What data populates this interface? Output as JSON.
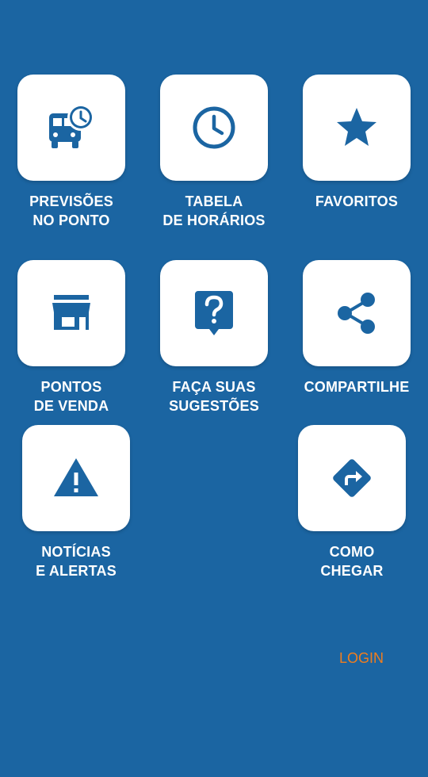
{
  "colors": {
    "background": "#1B65A2",
    "tile": "#FFFFFF",
    "icon": "#1B65A2",
    "label": "#FFFFFF",
    "login": "#F07D1E"
  },
  "menu": {
    "previsoes": {
      "icon": "bus-clock-icon",
      "line1": "PREVISÕES",
      "line2": "NO PONTO"
    },
    "tabela": {
      "icon": "clock-icon",
      "line1": "TABELA",
      "line2": "DE HORÁRIOS"
    },
    "favoritos": {
      "icon": "star-icon",
      "line1": "FAVORITOS"
    },
    "pontos_venda": {
      "icon": "store-icon",
      "line1": "PONTOS",
      "line2": "DE VENDA"
    },
    "sugestoes": {
      "icon": "question-feedback-icon",
      "line1": "FAÇA SUAS",
      "line2": "SUGESTÕES"
    },
    "compartilhe": {
      "icon": "share-icon",
      "line1": "COMPARTILHE"
    },
    "noticias": {
      "icon": "warning-icon",
      "line1": "NOTÍCIAS",
      "line2": "E ALERTAS"
    },
    "como_chegar": {
      "icon": "directions-icon",
      "line1": "COMO",
      "line2": "CHEGAR"
    }
  },
  "login_label": "LOGIN"
}
